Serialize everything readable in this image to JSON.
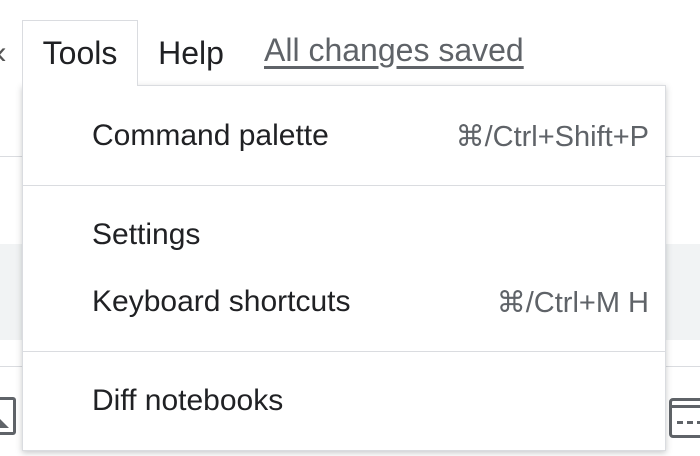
{
  "menubar": {
    "items": [
      {
        "label": "Tools",
        "open": true
      },
      {
        "label": "Help",
        "open": false
      }
    ],
    "save_status": "All changes saved"
  },
  "tools_menu": {
    "groups": [
      [
        {
          "label": "Command palette",
          "shortcut": "⌘/Ctrl+Shift+P"
        }
      ],
      [
        {
          "label": "Settings",
          "shortcut": ""
        },
        {
          "label": "Keyboard shortcuts",
          "shortcut": "⌘/Ctrl+M H"
        }
      ],
      [
        {
          "label": "Diff notebooks",
          "shortcut": ""
        }
      ]
    ]
  },
  "background": {
    "icons": [
      "image-icon",
      "console-icon"
    ]
  },
  "colors": {
    "text": "#202124",
    "secondary_text": "#5f6368",
    "divider": "#dadce0",
    "band": "#f1f3f4"
  }
}
